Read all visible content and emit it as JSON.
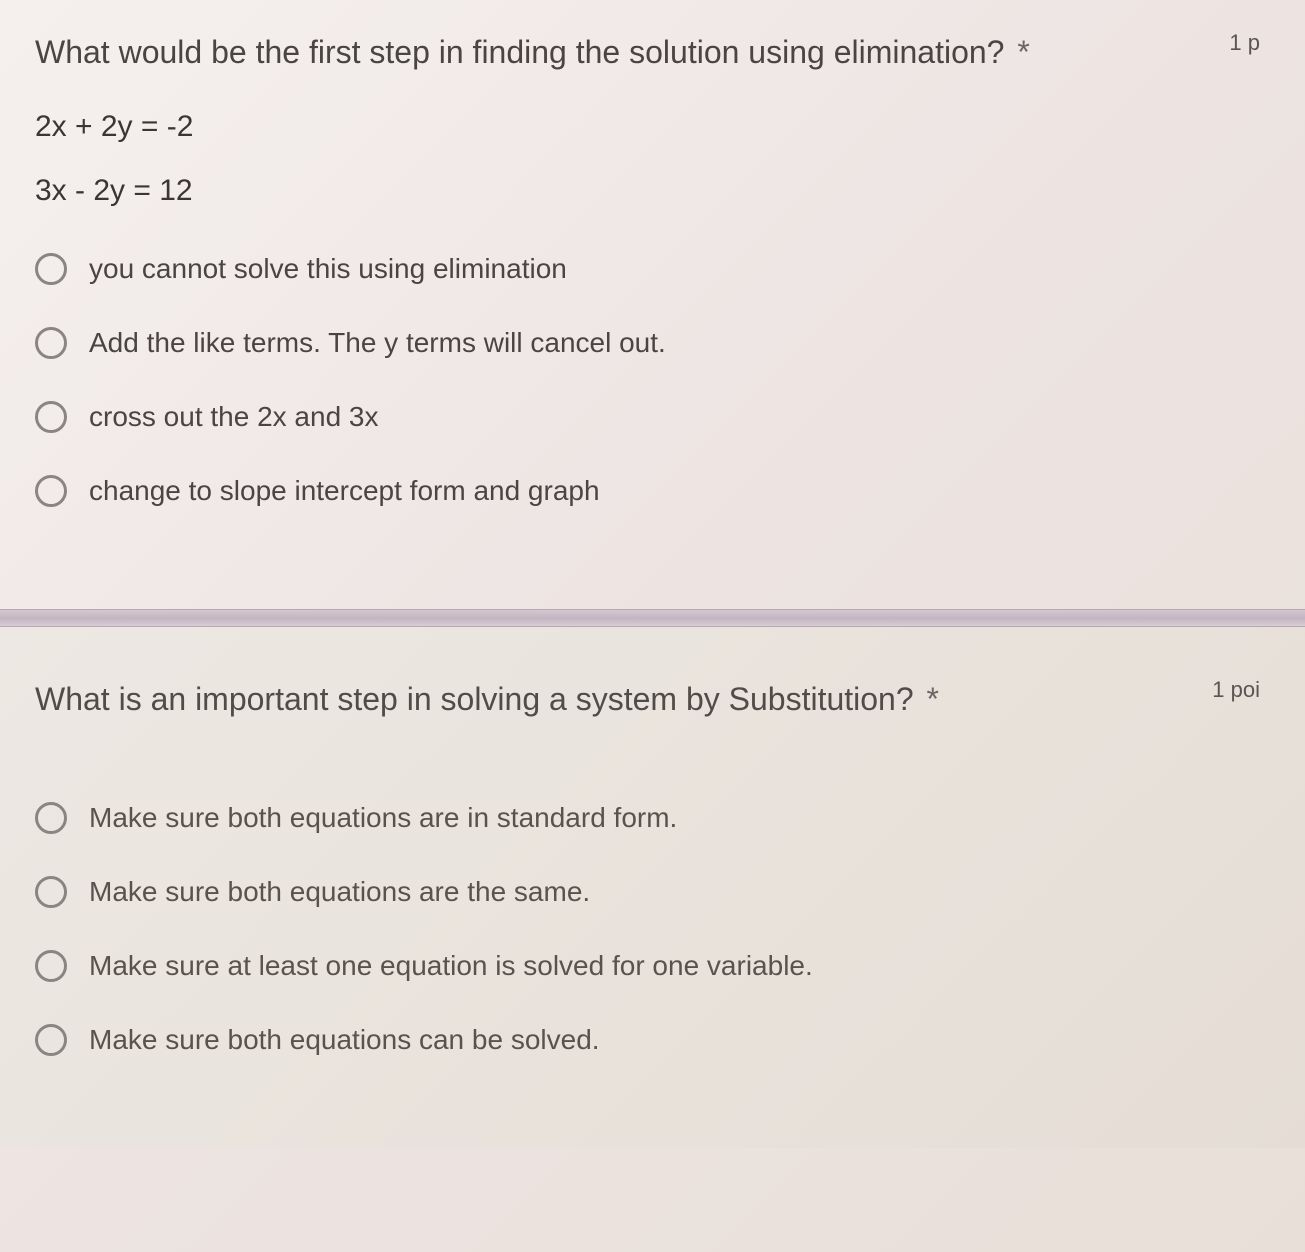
{
  "question1": {
    "text": "What would be the first step in finding the solution using elimination?",
    "asterisk": "*",
    "points": "1 p",
    "equation1": "2x + 2y = -2",
    "equation2": "3x - 2y = 12",
    "options": [
      "you cannot solve this using elimination",
      "Add the like terms. The y terms will cancel out.",
      "cross out the 2x and 3x",
      "change to slope intercept form and graph"
    ]
  },
  "question2": {
    "text": "What is an important step in solving a system by Substitution?",
    "asterisk": "*",
    "points": "1 poi",
    "options": [
      "Make sure both equations are in standard form.",
      "Make sure both equations are the same.",
      "Make sure at least one equation is solved for one variable.",
      "Make sure both equations can be solved."
    ]
  }
}
